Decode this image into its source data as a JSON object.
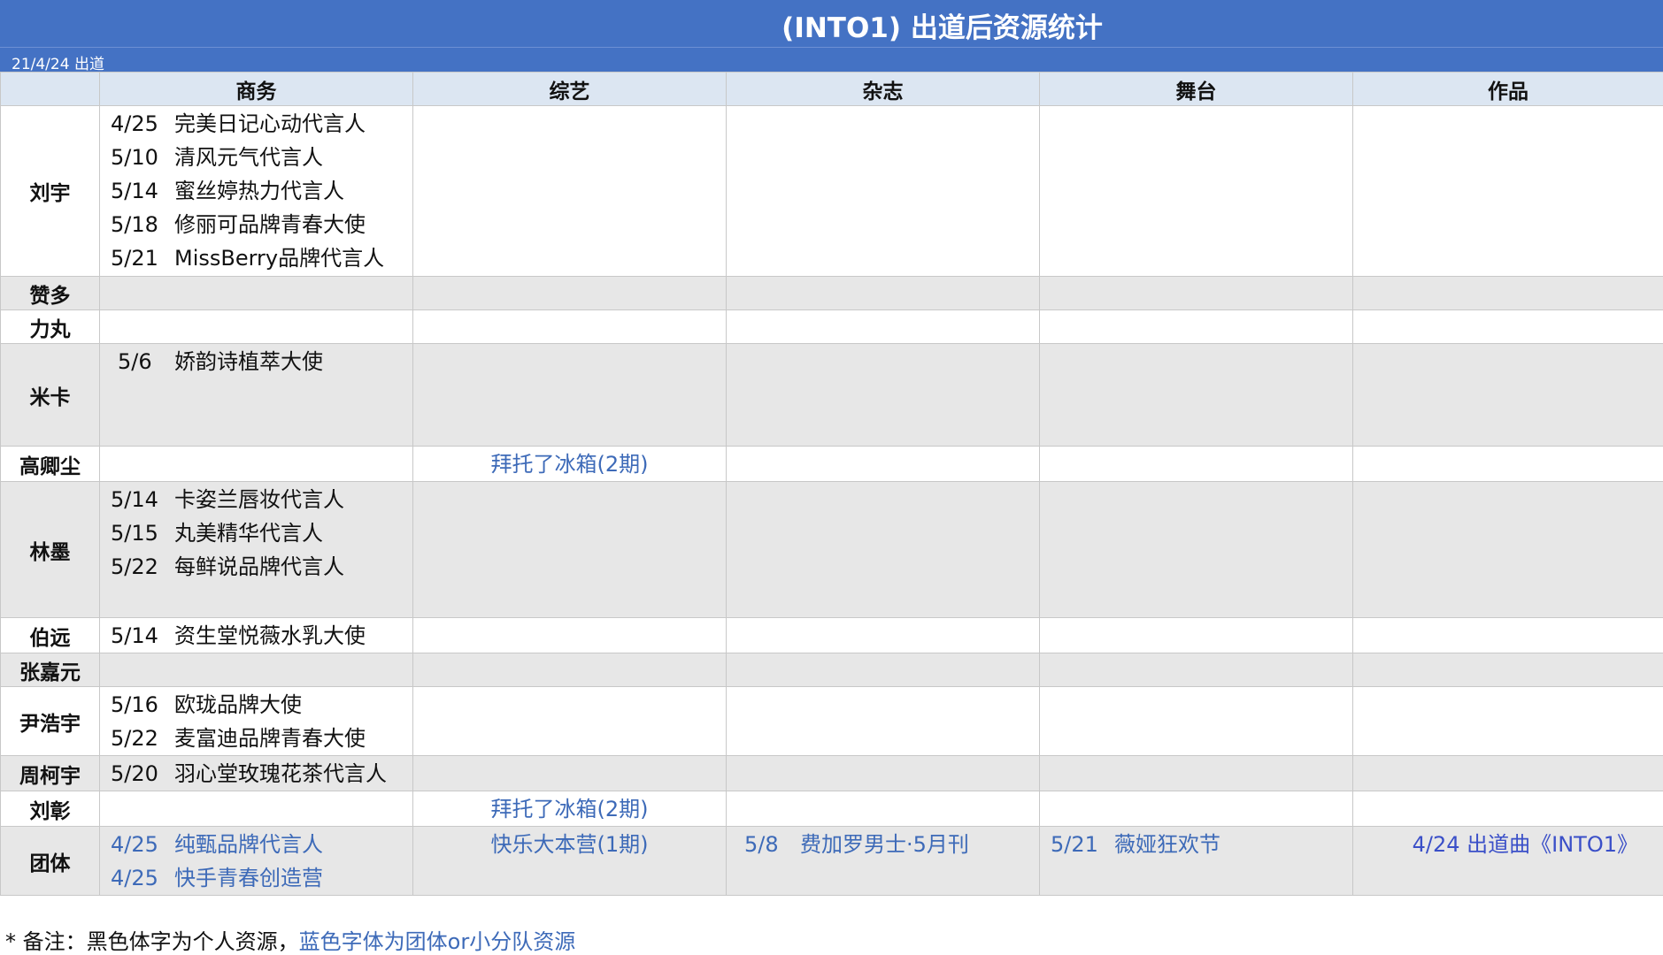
{
  "title": "(INTO1) 出道后资源统计",
  "debut_date": "21/4/24 出道",
  "columns": [
    "商务",
    "综艺",
    "杂志",
    "舞台",
    "作品"
  ],
  "rows": [
    {
      "name": "刘宇",
      "business": [
        {
          "date": "4/25",
          "text": "完美日记心动代言人"
        },
        {
          "date": "5/10",
          "text": "清风元气代言人"
        },
        {
          "date": "5/14",
          "text": "蜜丝婷热力代言人"
        },
        {
          "date": "5/18",
          "text": "修丽可品牌青春大使"
        },
        {
          "date": "5/21",
          "text": "MissBerry品牌代言人"
        }
      ]
    },
    {
      "name": "赞多",
      "business": []
    },
    {
      "name": "力丸",
      "business": []
    },
    {
      "name": "米卡",
      "business": [
        {
          "date": "5/6",
          "text": "娇韵诗植萃大使"
        }
      ]
    },
    {
      "name": "高卿尘",
      "business": [],
      "variety": "拜托了冰箱(2期)"
    },
    {
      "name": "林墨",
      "business": [
        {
          "date": "5/14",
          "text": "卡姿兰唇妆代言人"
        },
        {
          "date": "5/15",
          "text": "丸美精华代言人"
        },
        {
          "date": "5/22",
          "text": "每鲜说品牌代言人"
        }
      ]
    },
    {
      "name": "伯远",
      "business": [
        {
          "date": "5/14",
          "text": "资生堂悦薇水乳大使"
        }
      ]
    },
    {
      "name": "张嘉元",
      "business": []
    },
    {
      "name": "尹浩宇",
      "business": [
        {
          "date": "5/16",
          "text": "欧珑品牌大使"
        },
        {
          "date": "5/22",
          "text": "麦富迪品牌青春大使"
        }
      ]
    },
    {
      "name": "周柯宇",
      "business": [
        {
          "date": "5/20",
          "text": "羽心堂玫瑰花茶代言人"
        }
      ]
    },
    {
      "name": "刘彰",
      "business": [],
      "variety": "拜托了冰箱(2期)"
    },
    {
      "name": "团体",
      "business": [
        {
          "date": "4/25",
          "text": "纯甄品牌代言人"
        },
        {
          "date": "4/25",
          "text": "快手青春创造营"
        }
      ],
      "variety": "快乐大本营(1期)",
      "magazine": {
        "date": "5/8",
        "text": "费加罗男士·5月刊"
      },
      "stage": {
        "date": "5/21",
        "text": "薇娅狂欢节"
      },
      "works": "4/24 出道曲《INTO1》"
    }
  ],
  "note_prefix": "* 备注：黑色体字为个人资源，",
  "note_blue": "蓝色字体为团体or小分队资源",
  "colors": {
    "header_blue": "#4472c4",
    "col_header_bg": "#dce6f2",
    "row_gray": "#e7e7e7",
    "group_text": "#3d6ab8"
  }
}
